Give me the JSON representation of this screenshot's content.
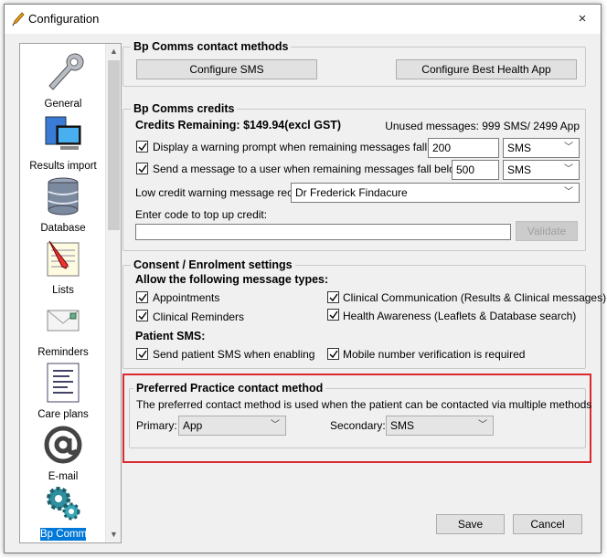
{
  "window": {
    "title": "Configuration",
    "close": "×"
  },
  "sidebar": {
    "items": [
      {
        "label": "General",
        "icon": "wrench-icon"
      },
      {
        "label": "Results import",
        "icon": "computer-import-icon"
      },
      {
        "label": "Database",
        "icon": "database-icon"
      },
      {
        "label": "Lists",
        "icon": "list-pencil-icon"
      },
      {
        "label": "Reminders",
        "icon": "envelope-icon"
      },
      {
        "label": "Care plans",
        "icon": "care-plan-icon"
      },
      {
        "label": "E-mail",
        "icon": "at-sign-icon"
      },
      {
        "label": "Bp Comms",
        "icon": "gears-icon"
      }
    ],
    "selected": "Bp Comms",
    "scroll_up": "▲",
    "scroll_down": "▼"
  },
  "contact_methods": {
    "title": "Bp Comms contact methods",
    "configure_sms": "Configure SMS",
    "configure_app": "Configure Best Health App"
  },
  "credits": {
    "title": "Bp Comms credits",
    "remaining": "Credits Remaining: $149.94(excl GST)",
    "unused": "Unused messages: 999 SMS/ 2499 App",
    "warn_label": "Display a warning prompt when remaining messages fall below:",
    "warn_value": "200",
    "warn_type": "SMS",
    "send_label": "Send a message to a user when remaining messages fall below:",
    "send_value": "500",
    "send_type": "SMS",
    "recipient_label": "Low credit warning message recipient:",
    "recipient_value": "Dr Frederick Findacure",
    "topup_label": "Enter code to top up credit:",
    "topup_value": "",
    "validate": "Validate"
  },
  "consent": {
    "title": "Consent / Enrolment settings",
    "allow_heading": "Allow the following message types:",
    "appointments": "Appointments",
    "clinical_reminders": "Clinical Reminders",
    "clinical_comm": "Clinical Communication (Results & Clinical messages)",
    "health_awareness": "Health Awareness (Leaflets & Database search)",
    "patient_sms_heading": "Patient SMS:",
    "send_patient_sms": "Send patient SMS when enabling",
    "mobile_verify": "Mobile number verification is required"
  },
  "preferred": {
    "title": "Preferred Practice contact method",
    "description": "The preferred contact method is used when the patient can be contacted via multiple methods",
    "primary_label": "Primary:",
    "primary_value": "App",
    "secondary_label": "Secondary:",
    "secondary_value": "SMS"
  },
  "footer": {
    "save": "Save",
    "cancel": "Cancel"
  },
  "colors": {
    "highlight": "#d9292f",
    "selected": "#0078d7"
  }
}
